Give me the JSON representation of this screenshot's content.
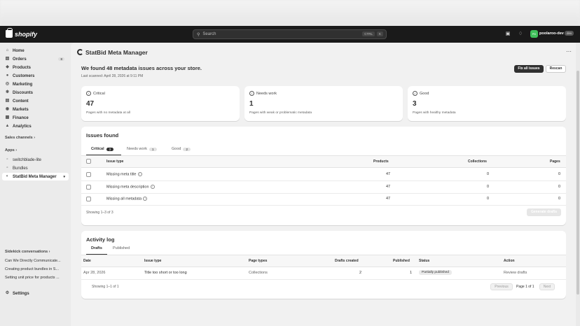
{
  "topbar": {
    "brand": "shopify",
    "search_placeholder": "Search",
    "shortcut_key1": "CTRL",
    "shortcut_key2": "K",
    "store_name": "poolaroo-dev",
    "dev_tag": "dev"
  },
  "sidebar": {
    "items": [
      {
        "label": "Home",
        "icon": "home-icon"
      },
      {
        "label": "Orders",
        "icon": "orders-icon",
        "count": "8"
      },
      {
        "label": "Products",
        "icon": "products-icon"
      },
      {
        "label": "Customers",
        "icon": "customers-icon"
      },
      {
        "label": "Marketing",
        "icon": "marketing-icon"
      },
      {
        "label": "Discounts",
        "icon": "discounts-icon"
      },
      {
        "label": "Content",
        "icon": "content-icon"
      },
      {
        "label": "Markets",
        "icon": "markets-icon"
      },
      {
        "label": "Finance",
        "icon": "finance-icon"
      },
      {
        "label": "Analytics",
        "icon": "analytics-icon"
      }
    ],
    "sales_channels": "Sales channels",
    "apps_heading": "Apps",
    "apps": [
      {
        "label": "switchblade-lite"
      },
      {
        "label": "Bundles"
      },
      {
        "label": "StatBid Meta Manager"
      }
    ],
    "sidekick_heading": "Sidekick conversations",
    "conversations": [
      "Can We Directly Communicate...",
      "Creating product bundles in S...",
      "Setting unit price for products ..."
    ],
    "settings": "Settings"
  },
  "app": {
    "title": "StatBid Meta Manager",
    "headline": "We found 48 metadata issues across your store.",
    "last_scanned": "Last scanned: April 28, 2026 at 9:11 PM",
    "fix_all": "Fix all issues",
    "rescan": "Rescan"
  },
  "stats": [
    {
      "label": "Critical",
      "value": "47",
      "desc": "Pages with no metadata at all"
    },
    {
      "label": "Needs work",
      "value": "1",
      "desc": "Pages with weak or problematic metadata"
    },
    {
      "label": "Good",
      "value": "3",
      "desc": "Pages with healthy metadata"
    }
  ],
  "issues": {
    "title": "Issues found",
    "tabs": [
      {
        "label": "Critical",
        "count": "3"
      },
      {
        "label": "Needs work",
        "count": "1"
      },
      {
        "label": "Good",
        "count": "2"
      }
    ],
    "columns": [
      "Issue type",
      "Products",
      "Collections",
      "Pages"
    ],
    "rows": [
      {
        "type": "Missing meta title",
        "products": "47",
        "collections": "0",
        "pages": "0"
      },
      {
        "type": "Missing meta description",
        "products": "47",
        "collections": "0",
        "pages": "0"
      },
      {
        "type": "Missing all metadata",
        "products": "47",
        "collections": "0",
        "pages": "0"
      }
    ],
    "showing": "Showing 1–3 of 3",
    "generate": "Generate drafts"
  },
  "activity": {
    "title": "Activity log",
    "tabs": [
      "Drafts",
      "Published"
    ],
    "columns": [
      "Date",
      "Issue type",
      "Page types",
      "Drafts created",
      "Published",
      "Status",
      "Action"
    ],
    "rows": [
      {
        "date": "Apr 28, 2026",
        "issue": "Title too short or too long",
        "page_type": "Collections",
        "drafts": "2",
        "published": "1",
        "status": "Partially published",
        "action": "Review drafts"
      }
    ],
    "showing": "Showing 1–1 of 1",
    "prev": "Previous",
    "page": "Page 1 of 1",
    "next": "Next"
  }
}
